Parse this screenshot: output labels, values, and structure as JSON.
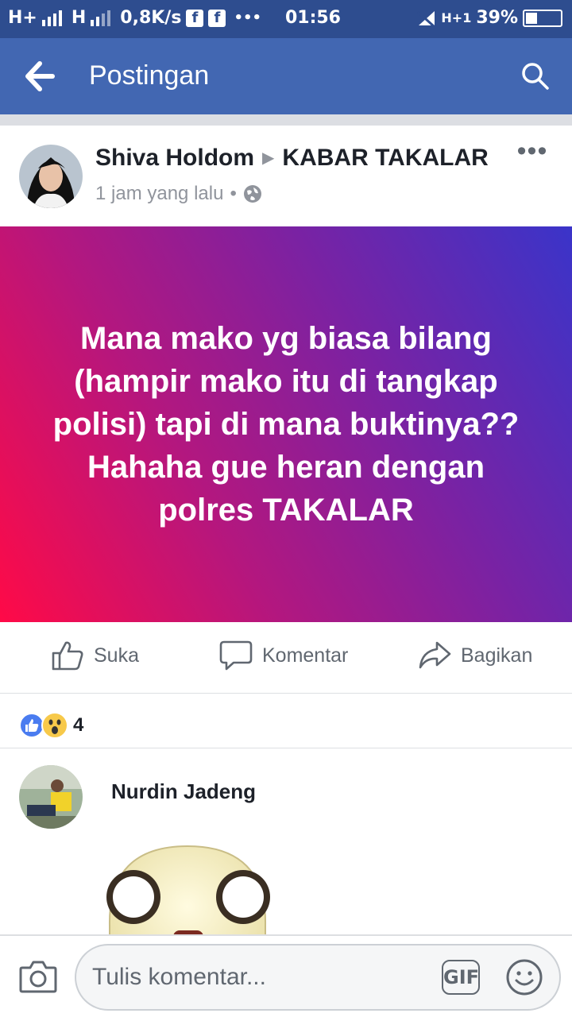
{
  "status_bar": {
    "network_left": "H+",
    "network_right": "H",
    "speed": "0,8K/s",
    "time": "01:56",
    "network_indicator": "H+1",
    "battery": "39%",
    "more": "•••",
    "fb_glyph": "f"
  },
  "app_bar": {
    "title": "Postingan",
    "back_icon": "arrow-left-icon",
    "search_icon": "search-icon"
  },
  "post": {
    "author": "Shiva Holdom",
    "group": "KABAR TAKALAR",
    "time": "1 jam yang lalu",
    "separator": "•",
    "privacy_icon": "globe-icon",
    "text": "Mana mako yg biasa bilang\n(hampir mako itu di tangkap polisi) tapi di mana buktinya??\nHahaha gue heran dengan polres TAKALAR",
    "background_gradient": [
      "#ff0a47",
      "#b3177f",
      "#7a22a3",
      "#3a34c9"
    ]
  },
  "actions": {
    "like": "Suka",
    "comment": "Komentar",
    "share": "Bagikan"
  },
  "reactions": {
    "count": "4",
    "types": [
      "like",
      "wow"
    ]
  },
  "comment": {
    "author": "Nurdin Jadeng",
    "sticker": "surprised-face-sticker"
  },
  "composer": {
    "placeholder": "Tulis komentar...",
    "gif_label": "GIF"
  },
  "colors": {
    "status_bar": "#2e4d8f",
    "app_bar": "#4267b2",
    "text_secondary": "#606770",
    "like_blue": "#4a7cf0"
  }
}
